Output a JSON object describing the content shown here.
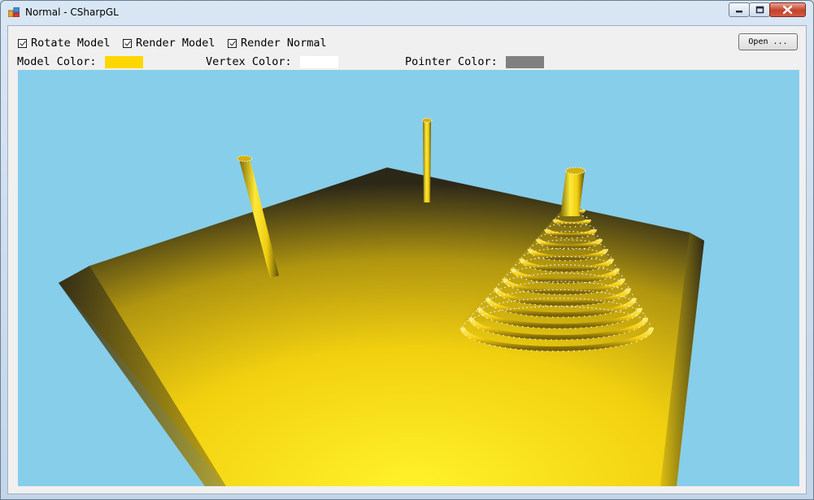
{
  "window": {
    "title": "Normal - CSharpGL"
  },
  "toolbar": {
    "rotate_model_label": "Rotate Model",
    "rotate_model_checked": true,
    "render_model_label": "Render Model",
    "render_model_checked": true,
    "render_normal_label": "Render Normal",
    "render_normal_checked": true,
    "open_button_label": "Open ..."
  },
  "colors": {
    "model_label": "Model Color:",
    "model_value": "#ffd700",
    "vertex_label": "Vertex Color:",
    "vertex_value": "#ffffff",
    "pointer_label": "Pointer Color:",
    "pointer_value": "#808080"
  },
  "viewport": {
    "background": "#87ceea",
    "model_color": "#ffd700"
  }
}
